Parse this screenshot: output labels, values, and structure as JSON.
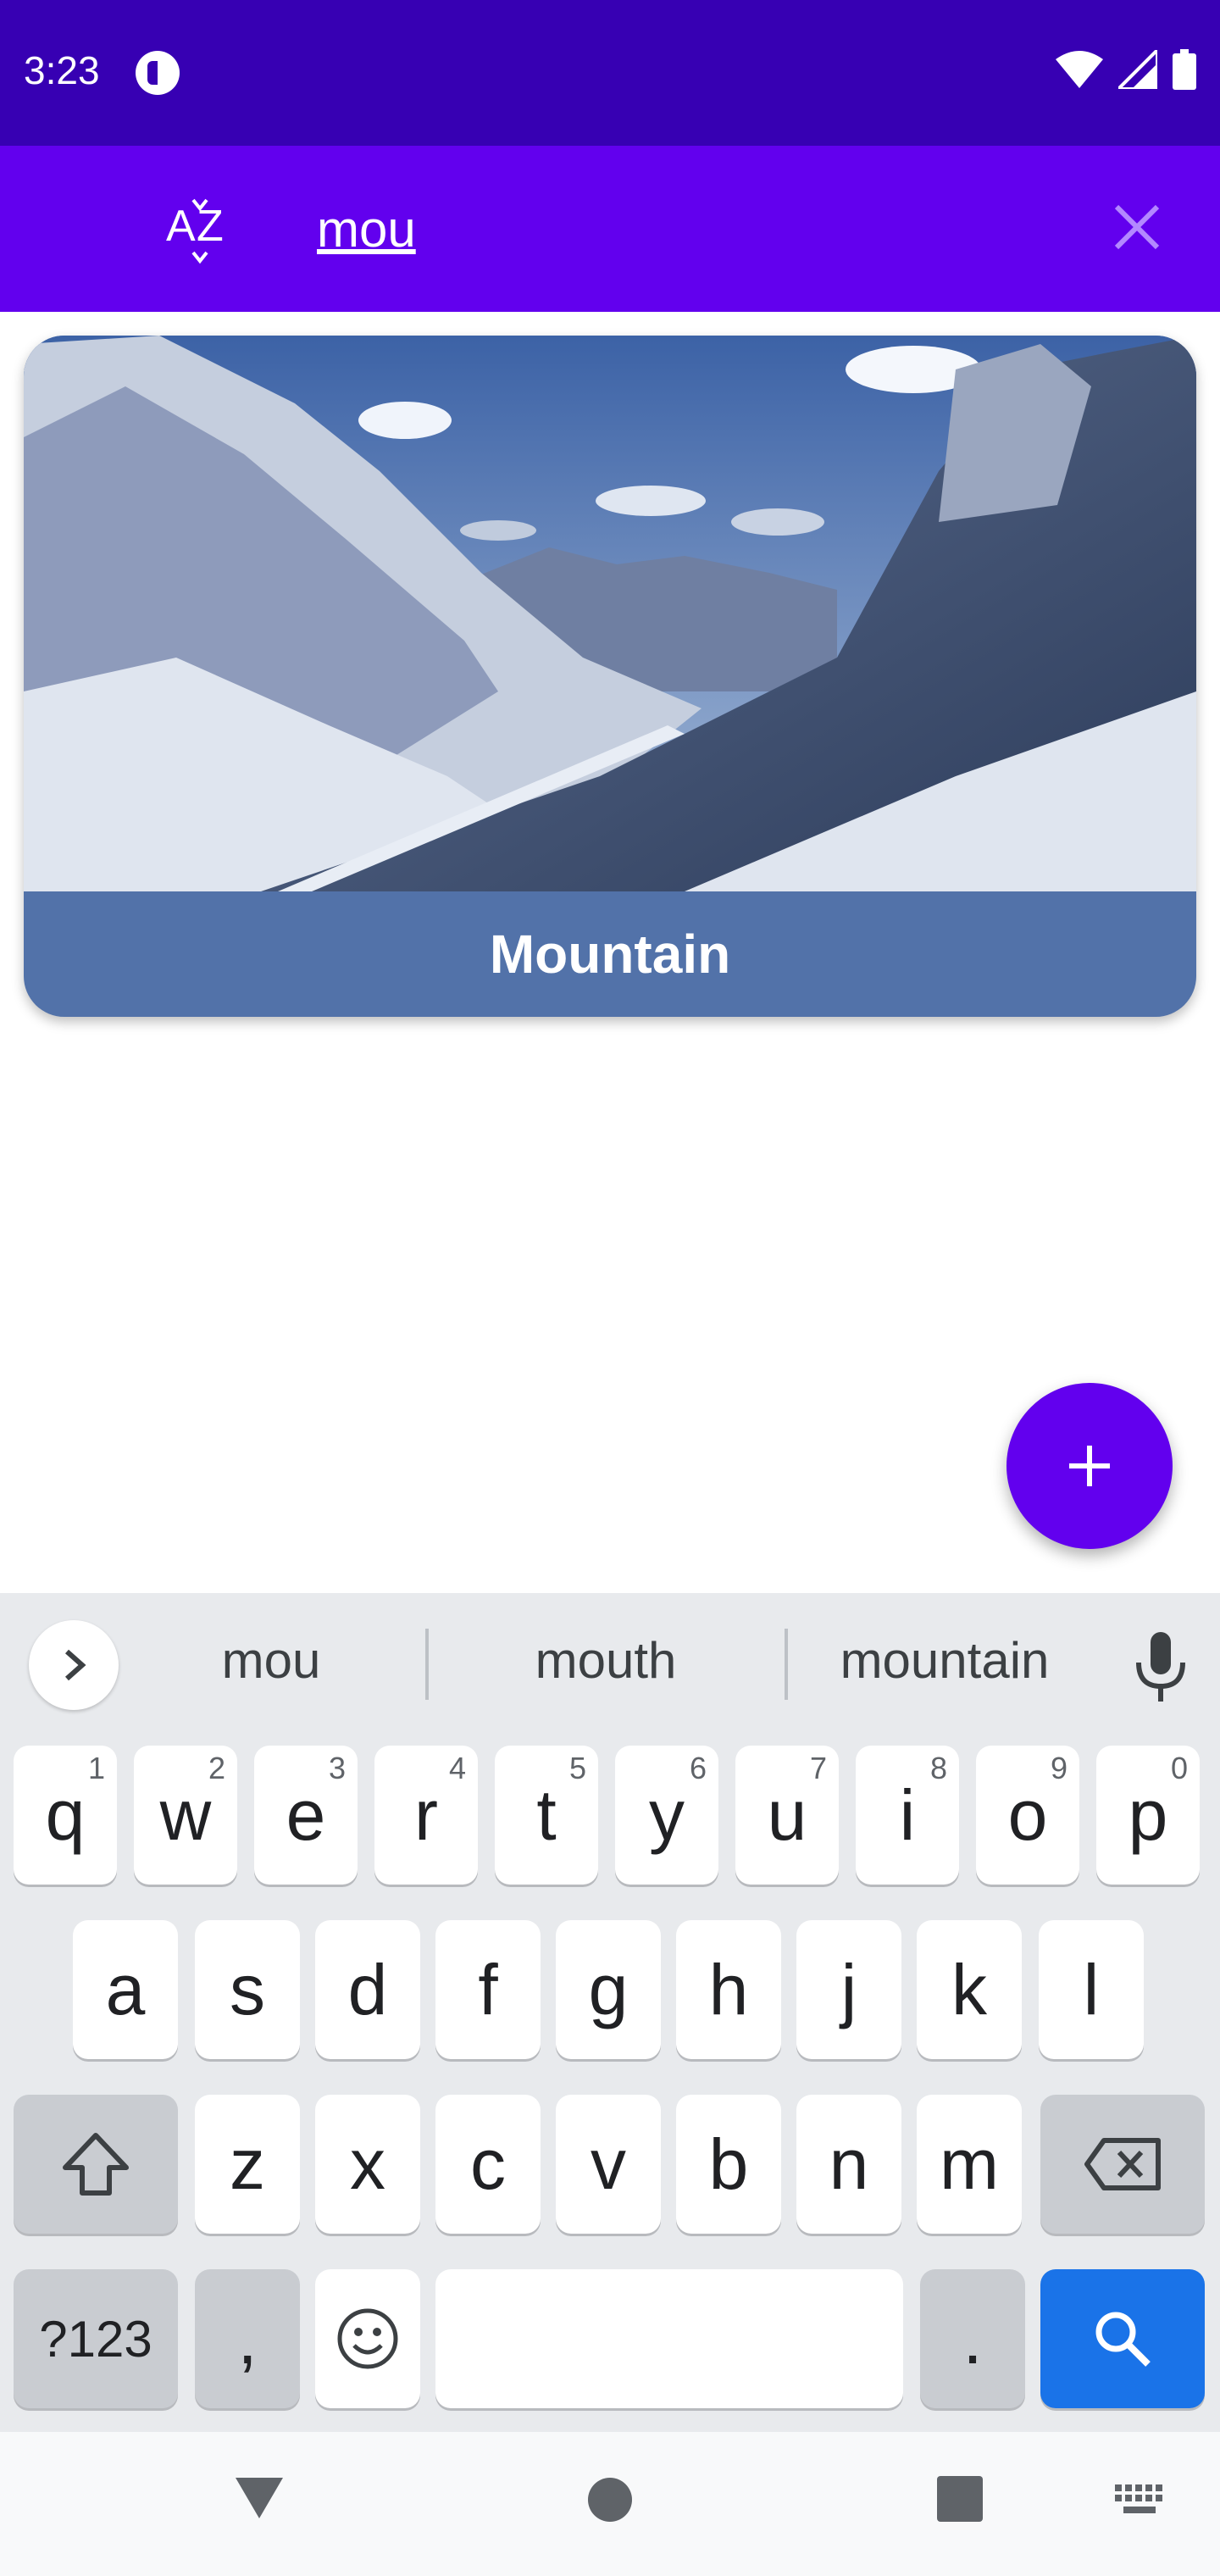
{
  "status_bar": {
    "time": "3:23"
  },
  "app_bar": {
    "search_value": "mou"
  },
  "card": {
    "label": "Mountain"
  },
  "keyboard": {
    "suggestions": [
      "mou",
      "mouth",
      "mountain"
    ],
    "row1": [
      {
        "key": "q",
        "hint": "1"
      },
      {
        "key": "w",
        "hint": "2"
      },
      {
        "key": "e",
        "hint": "3"
      },
      {
        "key": "r",
        "hint": "4"
      },
      {
        "key": "t",
        "hint": "5"
      },
      {
        "key": "y",
        "hint": "6"
      },
      {
        "key": "u",
        "hint": "7"
      },
      {
        "key": "i",
        "hint": "8"
      },
      {
        "key": "o",
        "hint": "9"
      },
      {
        "key": "p",
        "hint": "0"
      }
    ],
    "row2": [
      "a",
      "s",
      "d",
      "f",
      "g",
      "h",
      "j",
      "k",
      "l"
    ],
    "row3": [
      "z",
      "x",
      "c",
      "v",
      "b",
      "n",
      "m"
    ],
    "symbols_label": "?123",
    "comma_label": ",",
    "period_label": "."
  },
  "colors": {
    "status_bar": "#3700b3",
    "app_bar": "#6200ee",
    "card_label_bg": "#5272a9",
    "fab": "#6200ee",
    "keyboard_action": "#1a73e8"
  }
}
